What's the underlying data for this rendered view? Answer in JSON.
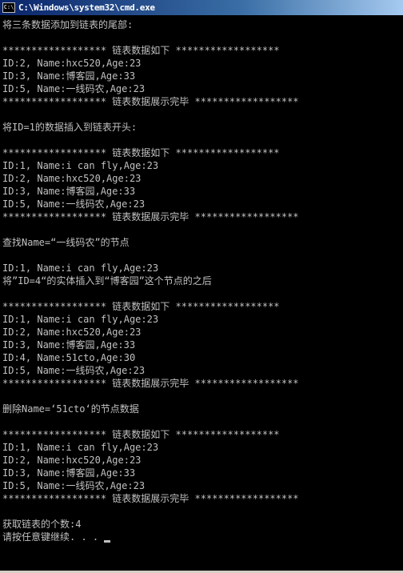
{
  "window": {
    "title": "C:\\Windows\\system32\\cmd.exe",
    "icon_label": "C:\\"
  },
  "console": {
    "lines": [
      "将三条数据添加到链表的尾部:",
      "",
      "****************** 链表数据如下 ******************",
      "ID:2, Name:hxc520,Age:23",
      "ID:3, Name:博客园,Age:33",
      "ID:5, Name:一线码农,Age:23",
      "****************** 链表数据展示完毕 ******************",
      "",
      "将ID=1的数据插入到链表开头:",
      "",
      "****************** 链表数据如下 ******************",
      "ID:1, Name:i can fly,Age:23",
      "ID:2, Name:hxc520,Age:23",
      "ID:3, Name:博客园,Age:33",
      "ID:5, Name:一线码农,Age:23",
      "****************** 链表数据展示完毕 ******************",
      "",
      "查找Name=“一线码农”的节点",
      "",
      "ID:1, Name:i can fly,Age:23",
      "将”ID=4“的实体插入到“博客园”这个节点的之后",
      "",
      "****************** 链表数据如下 ******************",
      "ID:1, Name:i can fly,Age:23",
      "ID:2, Name:hxc520,Age:23",
      "ID:3, Name:博客园,Age:33",
      "ID:4, Name:51cto,Age:30",
      "ID:5, Name:一线码农,Age:23",
      "****************** 链表数据展示完毕 ******************",
      "",
      "删除Name=‘51cto‘的节点数据",
      "",
      "****************** 链表数据如下 ******************",
      "ID:1, Name:i can fly,Age:23",
      "ID:2, Name:hxc520,Age:23",
      "ID:3, Name:博客园,Age:33",
      "ID:5, Name:一线码农,Age:23",
      "****************** 链表数据展示完毕 ******************",
      "",
      "获取链表的个数:4",
      "请按任意键继续. . ."
    ]
  },
  "colors": {
    "console_bg": "#000000",
    "console_text": "#c0c0c0",
    "titlebar_start": "#0a246a",
    "titlebar_end": "#a6caf0"
  }
}
